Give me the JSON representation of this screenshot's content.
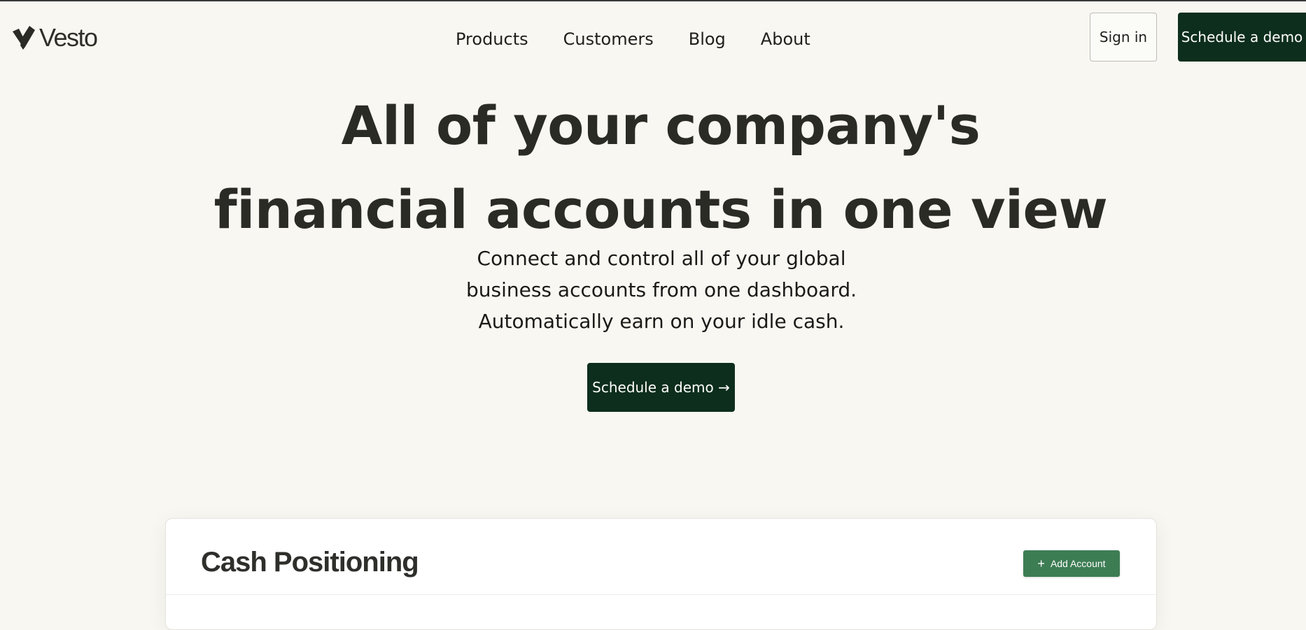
{
  "header": {
    "logo_text": "Vesto",
    "nav": [
      {
        "label": "Products"
      },
      {
        "label": "Customers"
      },
      {
        "label": "Blog"
      },
      {
        "label": "About"
      }
    ],
    "sign_in_label": "Sign in",
    "demo_label": "Schedule a demo"
  },
  "hero": {
    "title_line1": "All of your company's",
    "title_line2": "financial accounts in one view",
    "subtitle": "Connect and control all of your global business accounts from one dashboard. Automatically earn on your idle cash.",
    "cta_label": "Schedule a demo →"
  },
  "dashboard": {
    "title": "Cash Positioning",
    "add_account_label": "Add Account",
    "add_icon": "plus-icon"
  },
  "colors": {
    "background": "#f8f7f1",
    "primary_dark_green": "#0d2e1c",
    "accent_green": "#3d7d54",
    "text": "#2b2b26"
  }
}
